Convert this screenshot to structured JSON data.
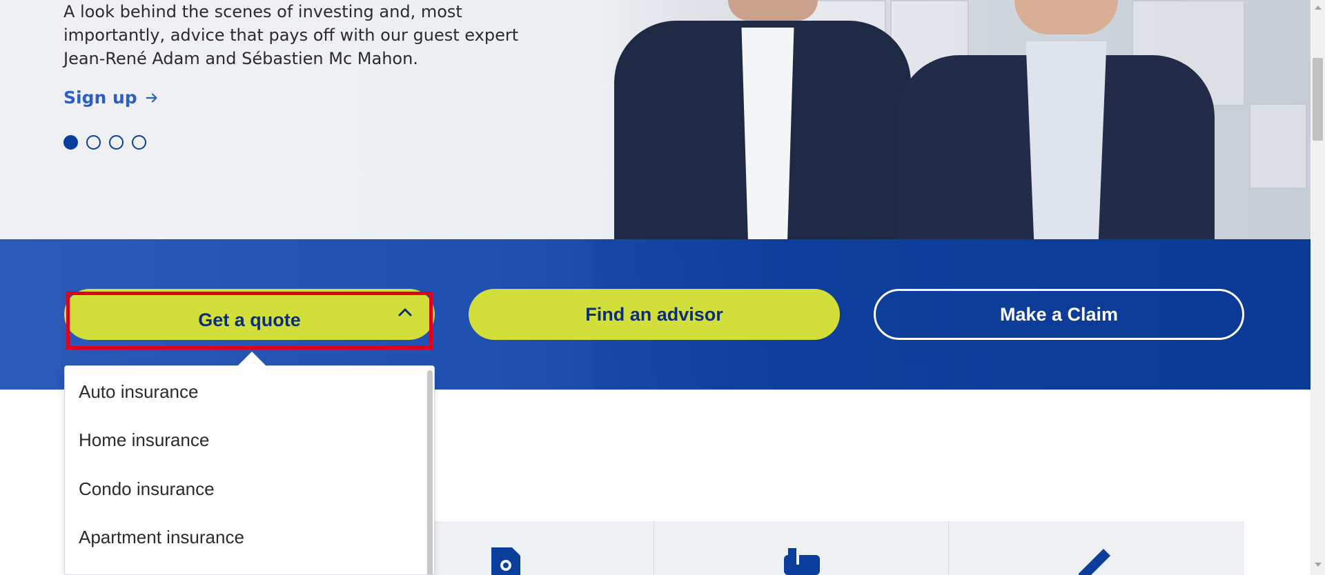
{
  "hero": {
    "description": "A look behind the scenes of investing and, most importantly, advice that pays off with our guest expert Jean-René Adam and Sébastien Mc Mahon.",
    "signup_label": "Sign up",
    "carousel": {
      "total_slides": 4,
      "active_slide": 1
    }
  },
  "actions": {
    "quote_label": "Get a quote",
    "advisor_label": "Find an advisor",
    "claim_label": "Make a Claim"
  },
  "quote_menu": {
    "items": [
      "Auto insurance",
      "Home insurance",
      "Condo insurance",
      "Apartment insurance"
    ]
  },
  "colors": {
    "brand_blue": "#0a3d9c",
    "lime": "#d2de3a",
    "highlight": "#e3001b"
  },
  "icons": [
    "arrow-right-icon",
    "chevron-up-icon",
    "location-tag-icon",
    "mailbox-icon",
    "pencil-icon"
  ]
}
